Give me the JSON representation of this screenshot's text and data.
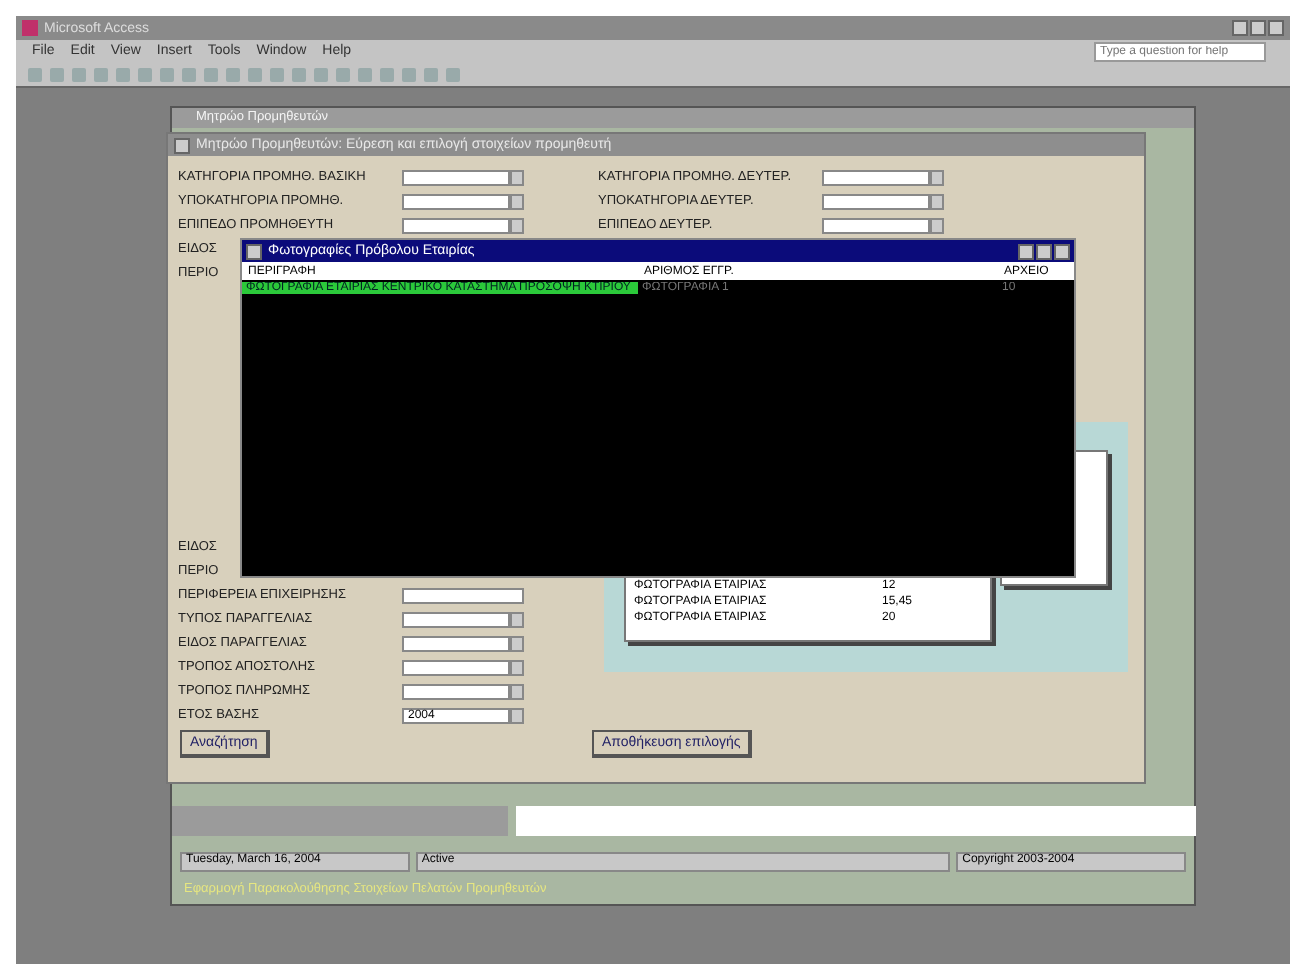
{
  "window": {
    "title": "Microsoft Access"
  },
  "menu": [
    "File",
    "Edit",
    "View",
    "Insert",
    "Tools",
    "Window",
    "Help"
  ],
  "help_box": {
    "placeholder": "Type a question for help"
  },
  "back_window": {
    "title": "Μητρώο Προμηθευτών"
  },
  "form": {
    "title": "Μητρώο Προμηθευτών: Εύρεση και επιλογή στοιχείων προμηθευτή",
    "left_fields": [
      {
        "label": "ΚΑΤΗΓΟΡΙΑ ΠΡΟΜΗΘ. ΒΑΣΙΚΗ",
        "kind": "combo"
      },
      {
        "label": "ΥΠΟΚΑΤΗΓΟΡΙΑ ΠΡΟΜΗΘ.",
        "kind": "combo"
      },
      {
        "label": "ΕΠΙΠΕΔΟ ΠΡΟΜΗΘΕΥΤΗ",
        "kind": "combo"
      },
      {
        "label": "ΕΙΔΟΣ",
        "kind": "hidden"
      },
      {
        "label": "ΠΕΡΙΟ",
        "kind": "hidden"
      }
    ],
    "left_fields_lower": [
      {
        "label": "ΕΙΔΟΣ",
        "kind": "hidden"
      },
      {
        "label": "ΠΕΡΙΟ",
        "kind": "hidden"
      },
      {
        "label": "ΠΕΡΙΦΕΡΕΙΑ ΕΠΙΧΕΙΡΗΣΗΣ",
        "kind": "text"
      },
      {
        "label": "ΤΥΠΟΣ ΠΑΡΑΓΓΕΛΙΑΣ",
        "kind": "combo"
      },
      {
        "label": "ΕΙΔΟΣ ΠΑΡΑΓΓΕΛΙΑΣ",
        "kind": "combo"
      },
      {
        "label": "ΤΡΟΠΟΣ ΑΠΟΣΤΟΛΗΣ",
        "kind": "combo"
      },
      {
        "label": "ΤΡΟΠΟΣ ΠΛΗΡΩΜΗΣ",
        "kind": "combo"
      },
      {
        "label": "ΕΤΟΣ ΒΑΣΗΣ",
        "kind": "combo",
        "value": "2004"
      }
    ],
    "right_fields": [
      {
        "label": "ΚΑΤΗΓΟΡΙΑ ΠΡΟΜΗΘ. ΔΕΥΤΕΡ.",
        "kind": "combo"
      },
      {
        "label": "ΥΠΟΚΑΤΗΓΟΡΙΑ ΔΕΥΤΕΡ.",
        "kind": "combo"
      },
      {
        "label": "ΕΠΙΠΕΔΟ ΔΕΥΤΕΡ.",
        "kind": "combo"
      }
    ],
    "list_rows": [
      {
        "name": "ΦΩΤΟΓΡΑΦΙΑ ΕΤΑΙΡΙΑΣ",
        "value": "12"
      },
      {
        "name": "ΦΩΤΟΓΡΑΦΙΑ ΕΤΑΙΡΙΑΣ",
        "value": "15,45"
      },
      {
        "name": "ΦΩΤΟΓΡΑΦΙΑ ΕΤΑΙΡΙΑΣ",
        "value": "20"
      }
    ],
    "buttons": [
      "Αναζήτηση",
      "Αποθήκευση επιλογής"
    ]
  },
  "dialog": {
    "title": "Φωτογραφίες Πρόβολου Εταιρίας",
    "columns": [
      "ΠΕΡΙΓΡΑΦΗ",
      "ΑΡΙΘΜΟΣ ΕΓΓΡ.",
      "ΑΡΧΕΙΟ"
    ],
    "rows": [
      {
        "cells": [
          "ΦΩΤΟΓΡΑΦΙΑ ΕΤΑΙΡΙΑΣ ΚΕΝΤΡΙΚΟ ΚΑΤΑΣΤΗΜΑ ΠΡΟΣΟΨΗ ΚΤΙΡΙΟΥ",
          "ΦΩΤΟΓΡΑΦΙΑ 1",
          "10"
        ],
        "selected": true
      }
    ]
  },
  "status_bar": [
    "Tuesday, March 16, 2004",
    "Active",
    "Copyright 2003-2004"
  ],
  "footer_note": "Εφαρμογή Παρακολούθησης Στοιχείων Πελατών Προμηθευτών"
}
